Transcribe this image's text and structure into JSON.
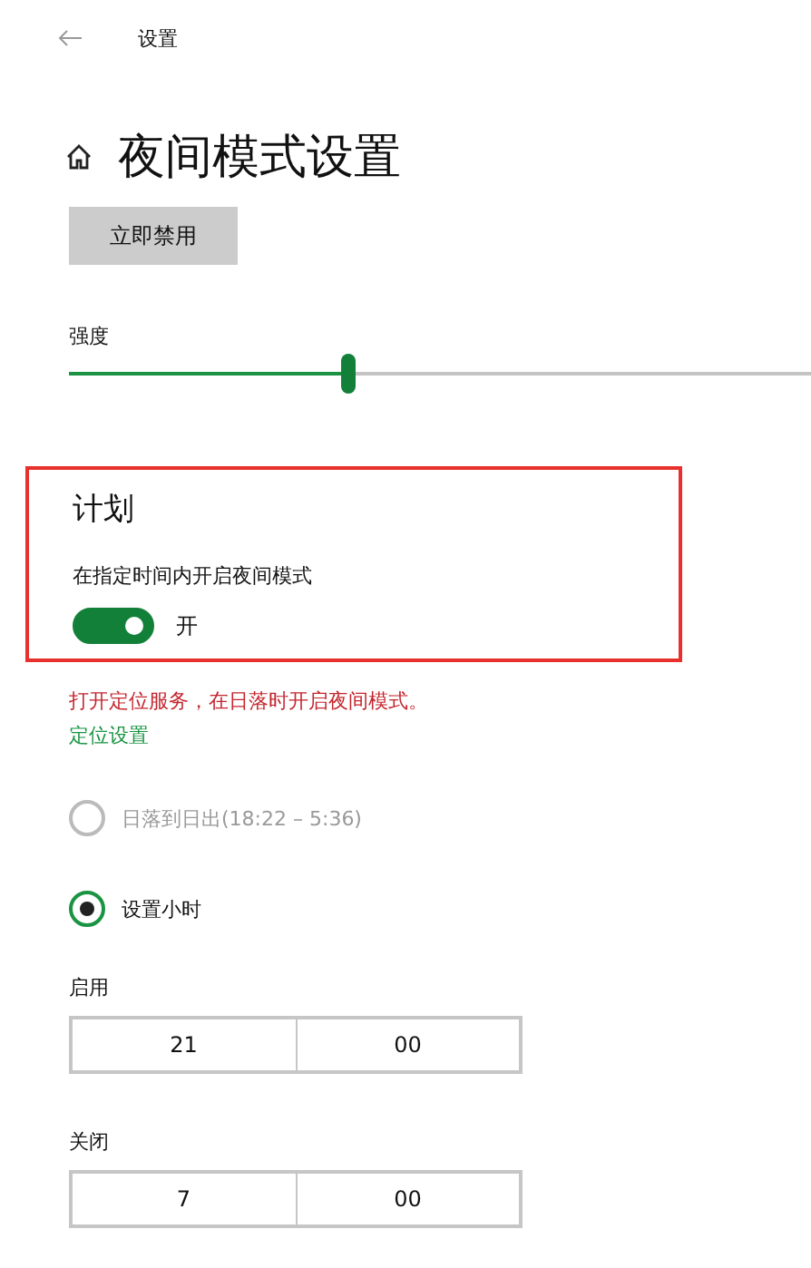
{
  "window": {
    "title": "设置"
  },
  "page": {
    "heading": "夜间模式设置"
  },
  "disable_button": {
    "label": "立即禁用"
  },
  "strength": {
    "label": "强度",
    "level": 0.377
  },
  "schedule": {
    "highlighted": true,
    "title": "计划",
    "description": "在指定时间内开启夜间模式",
    "toggle": {
      "on": true,
      "label": "开"
    }
  },
  "warning": "打开定位服务，在日落时开启夜间模式。",
  "location_link": "定位设置",
  "options": [
    {
      "label": "日落到日出(18:22 – 5:36)",
      "selected": false,
      "disabled": true
    },
    {
      "label": "设置小时",
      "selected": true,
      "disabled": false
    }
  ],
  "times": [
    {
      "label": "启用",
      "hour": "21",
      "minute": "00"
    },
    {
      "label": "关闭",
      "hour": "7",
      "minute": "00"
    }
  ]
}
